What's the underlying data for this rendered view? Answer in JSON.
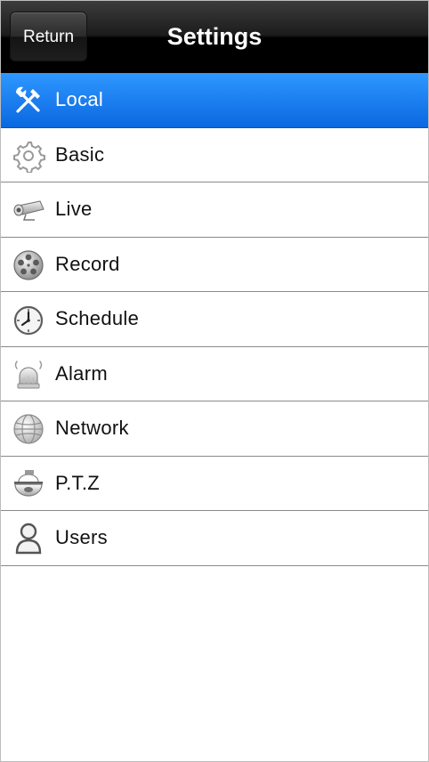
{
  "header": {
    "title": "Settings",
    "return_label": "Return"
  },
  "menu": {
    "selected_index": 0,
    "items": [
      {
        "label": "Local",
        "icon": "tools-icon"
      },
      {
        "label": "Basic",
        "icon": "gear-icon"
      },
      {
        "label": "Live",
        "icon": "camera-icon"
      },
      {
        "label": "Record",
        "icon": "film-reel-icon"
      },
      {
        "label": "Schedule",
        "icon": "clock-icon"
      },
      {
        "label": "Alarm",
        "icon": "alarm-bell-icon"
      },
      {
        "label": "Network",
        "icon": "globe-icon"
      },
      {
        "label": "P.T.Z",
        "icon": "ptz-dome-camera-icon"
      },
      {
        "label": "Users",
        "icon": "user-icon"
      }
    ]
  },
  "colors": {
    "selected_row": "#1c7ff0",
    "header": "#000000",
    "row_divider": "#8a8a8a"
  }
}
